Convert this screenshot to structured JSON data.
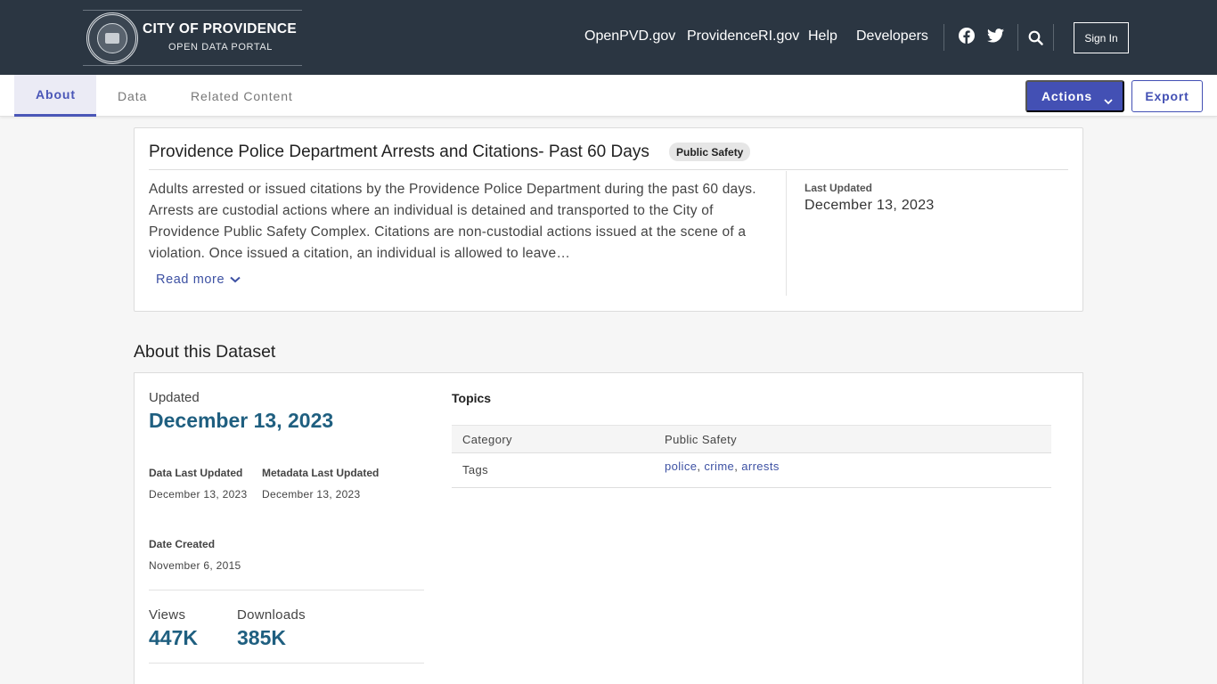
{
  "header": {
    "logo_title": "CITY OF PROVIDENCE",
    "logo_subtitle": "OPEN DATA PORTAL",
    "nav": [
      "OpenPVD.gov",
      "ProvidenceRI.gov",
      "Help",
      "Developers"
    ],
    "icons": [
      "facebook-icon",
      "twitter-icon",
      "search-icon"
    ],
    "signin_label": "Sign In"
  },
  "tabs": [
    "About",
    "Data",
    "Related Content"
  ],
  "active_tab": "About",
  "toolbar": {
    "actions_label": "Actions",
    "export_label": "Export"
  },
  "dataset": {
    "title": "Providence Police Department Arrests and Citations- Past 60 Days",
    "category_badge": "Public Safety",
    "description": "Adults arrested or issued citations by the Providence Police Department during the past 60 days. Arrests are custodial actions where an individual is detained and transported to the City of Providence Public Safety Complex. Citations are non-custodial actions issued at the scene of a violation. Once issued a citation, an individual is allowed to leave…",
    "read_more": "Read more",
    "last_updated_label": "Last Updated",
    "last_updated_value": "December 13, 2023"
  },
  "about": {
    "heading": "About this Dataset",
    "updated_label": "Updated",
    "updated_value": "December 13, 2023",
    "data_last_updated_label": "Data Last Updated",
    "data_last_updated_value": "December 13, 2023",
    "metadata_last_updated_label": "Metadata Last Updated",
    "metadata_last_updated_value": "December 13, 2023",
    "date_created_label": "Date Created",
    "date_created_value": "November 6, 2015",
    "views_label": "Views",
    "views_value": "447K",
    "downloads_label": "Downloads",
    "downloads_value": "385K"
  },
  "topics": {
    "title": "Topics",
    "category_label": "Category",
    "category_value": "Public Safety",
    "tags_label": "Tags",
    "tags": [
      "police",
      "crime",
      "arrests"
    ]
  },
  "colors": {
    "header_bg": "#2b3642",
    "accent": "#4350b4",
    "stat_blue": "#1f5f80",
    "link": "#3d51a3"
  }
}
